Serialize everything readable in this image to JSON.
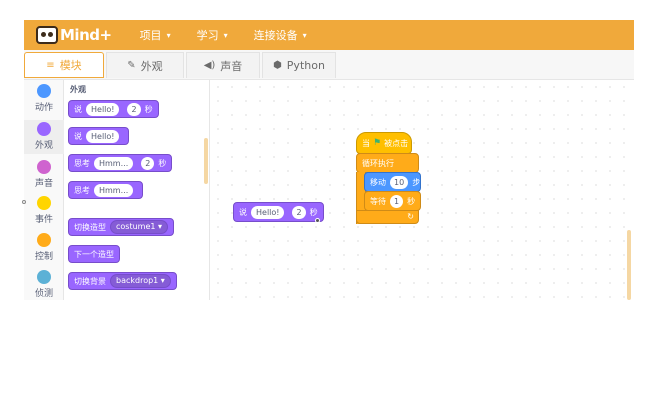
{
  "menubar": {
    "logo_text": "Mind+",
    "items": [
      {
        "label": "项目"
      },
      {
        "label": "学习"
      },
      {
        "label": "连接设备"
      }
    ],
    "caret": "▾"
  },
  "tabs": [
    {
      "label": "模块",
      "icon": "≡"
    },
    {
      "label": "外观",
      "icon": "✎"
    },
    {
      "label": "声音",
      "icon": "◀)"
    },
    {
      "label": "Python",
      "icon": "⬢"
    }
  ],
  "categories": [
    {
      "label": "动作",
      "color": "#4c97ff"
    },
    {
      "label": "外观",
      "color": "#9966ff"
    },
    {
      "label": "声音",
      "color": "#cf63cf"
    },
    {
      "label": "事件",
      "color": "#ffd500"
    },
    {
      "label": "控制",
      "color": "#ffab19"
    },
    {
      "label": "侦测",
      "color": "#5cb1d6"
    }
  ],
  "palette": {
    "section_title": "外观",
    "say_for": {
      "verb": "说",
      "text": "Hello!",
      "secs": "2",
      "unit": "秒"
    },
    "say": {
      "verb": "说",
      "text": "Hello!"
    },
    "think_for": {
      "verb": "思考",
      "text": "Hmm...",
      "secs": "2",
      "unit": "秒"
    },
    "think": {
      "verb": "思考",
      "text": "Hmm..."
    },
    "switch_costume": {
      "verb": "切换造型",
      "value": "costume1 ▾"
    },
    "next_costume": {
      "label": "下一个造型"
    },
    "switch_backdrop": {
      "verb": "切换背景",
      "value": "backdrop1 ▾"
    }
  },
  "workspace": {
    "say_block": {
      "verb": "说",
      "text": "Hello!",
      "secs": "2",
      "unit": "秒"
    },
    "script": {
      "hat": {
        "prefix": "当",
        "flag": "⚑",
        "suffix": "被点击"
      },
      "forever": "循环执行",
      "move": {
        "verb": "移动",
        "steps": "10",
        "unit": "步"
      },
      "wait": {
        "verb": "等待",
        "secs": "1",
        "unit": "秒"
      },
      "loop_arrow": "↻"
    }
  }
}
